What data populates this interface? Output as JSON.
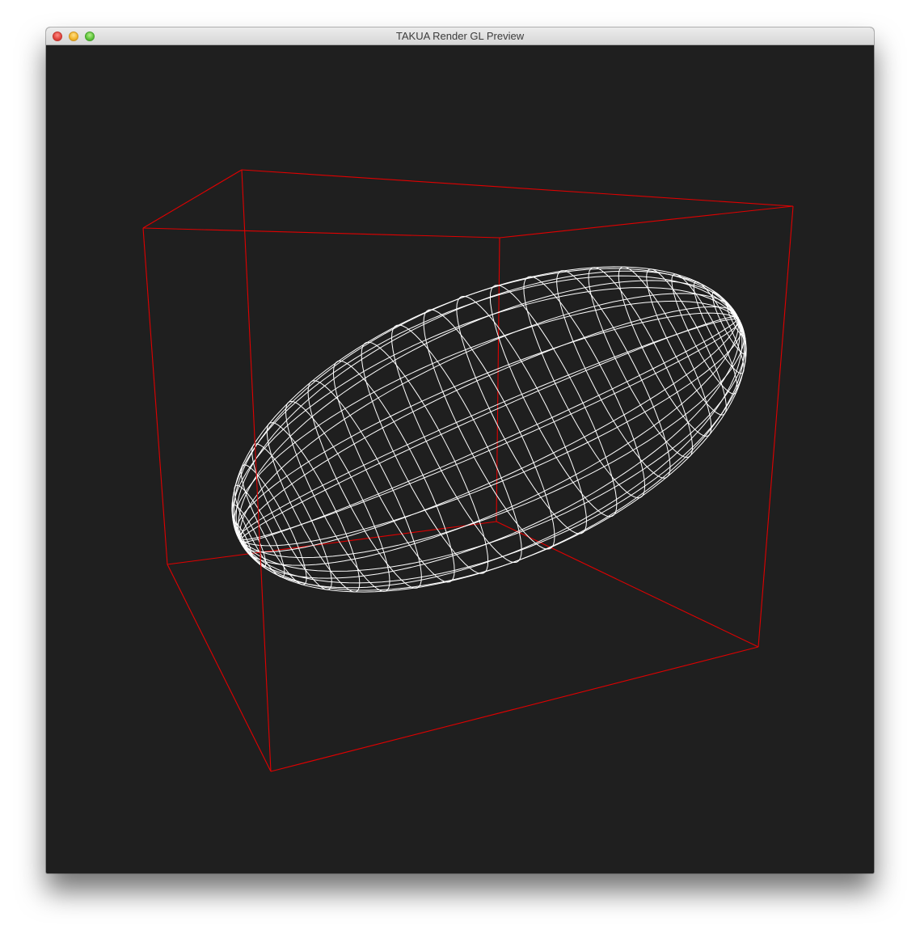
{
  "window": {
    "title": "TAKUA Render GL Preview"
  },
  "viewport": {
    "background_color": "#1f1f1f",
    "bounding_box_color": "#e00000",
    "wireframe_color": "#ffffff",
    "object": "ellipsoid-wireframe"
  }
}
